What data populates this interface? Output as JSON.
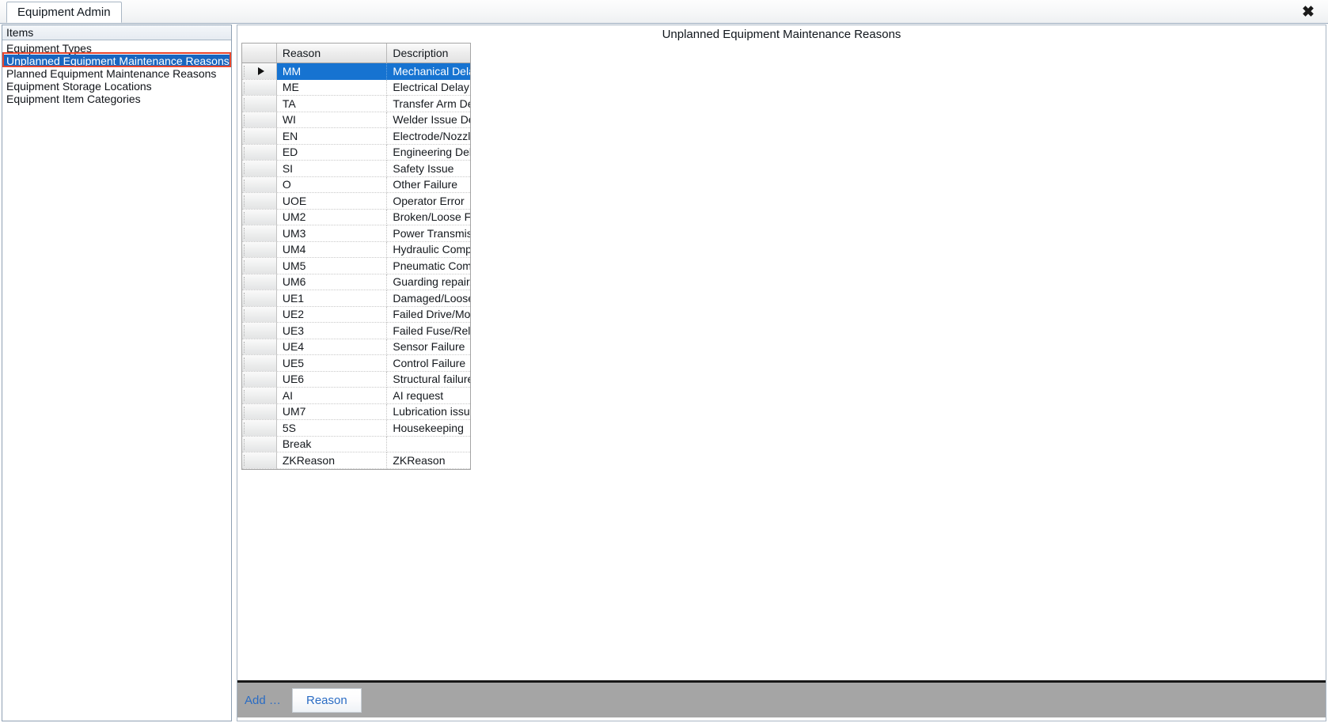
{
  "window": {
    "tab_label": "Equipment Admin",
    "close_icon": "close-x-icon",
    "close_glyph": "✖"
  },
  "sidebar": {
    "header": "Items",
    "selected_index": 1,
    "items": [
      {
        "label": "Equipment Types"
      },
      {
        "label": "Unplanned Equipment Maintenance Reasons"
      },
      {
        "label": "Planned Equipment Maintenance Reasons"
      },
      {
        "label": "Equipment Storage Locations"
      },
      {
        "label": "Equipment Item Categories"
      }
    ],
    "highlight_color": "#e8452c",
    "selection_color": "#1866c0"
  },
  "main": {
    "title": "Unplanned Equipment Maintenance Reasons",
    "grid": {
      "columns": [
        "Reason",
        "Description"
      ],
      "selected_row_index": 0,
      "row_pointer_icon": "row-selector-arrow-icon",
      "rows": [
        {
          "reason": "MM",
          "description": "Mechanical Delay"
        },
        {
          "reason": "ME",
          "description": "Electrical Delay"
        },
        {
          "reason": "TA",
          "description": "Transfer Arm De…"
        },
        {
          "reason": "WI",
          "description": "Welder Issue De…"
        },
        {
          "reason": "EN",
          "description": "Electrode/Nozzl…"
        },
        {
          "reason": "ED",
          "description": "Engineering Del…"
        },
        {
          "reason": "SI",
          "description": "Safety Issue"
        },
        {
          "reason": "O",
          "description": "Other Failure"
        },
        {
          "reason": "UOE",
          "description": "Operator Error"
        },
        {
          "reason": "UM2",
          "description": "Broken/Loose F…"
        },
        {
          "reason": "UM3",
          "description": "Power Transmis…"
        },
        {
          "reason": "UM4",
          "description": "Hydraulic Comp…"
        },
        {
          "reason": "UM5",
          "description": "Pneumatic Com…"
        },
        {
          "reason": "UM6",
          "description": "Guarding repair/I…"
        },
        {
          "reason": "UE1",
          "description": "Damaged/Loose…"
        },
        {
          "reason": "UE2",
          "description": "Failed Drive/Mot…"
        },
        {
          "reason": "UE3",
          "description": "Failed Fuse/Rel…"
        },
        {
          "reason": "UE4",
          "description": "Sensor Failure"
        },
        {
          "reason": "UE5",
          "description": "Control Failure"
        },
        {
          "reason": "UE6",
          "description": "Structural failure"
        },
        {
          "reason": "AI",
          "description": "AI request"
        },
        {
          "reason": "UM7",
          "description": "Lubrication issue"
        },
        {
          "reason": "5S",
          "description": "Housekeeping"
        },
        {
          "reason": "Break",
          "description": ""
        },
        {
          "reason": "ZKReason",
          "description": "ZKReason"
        }
      ]
    }
  },
  "toolbar": {
    "add_label": "Add …",
    "reason_button": "Reason",
    "link_color": "#2a6cc4",
    "background": "#a5a5a5"
  }
}
